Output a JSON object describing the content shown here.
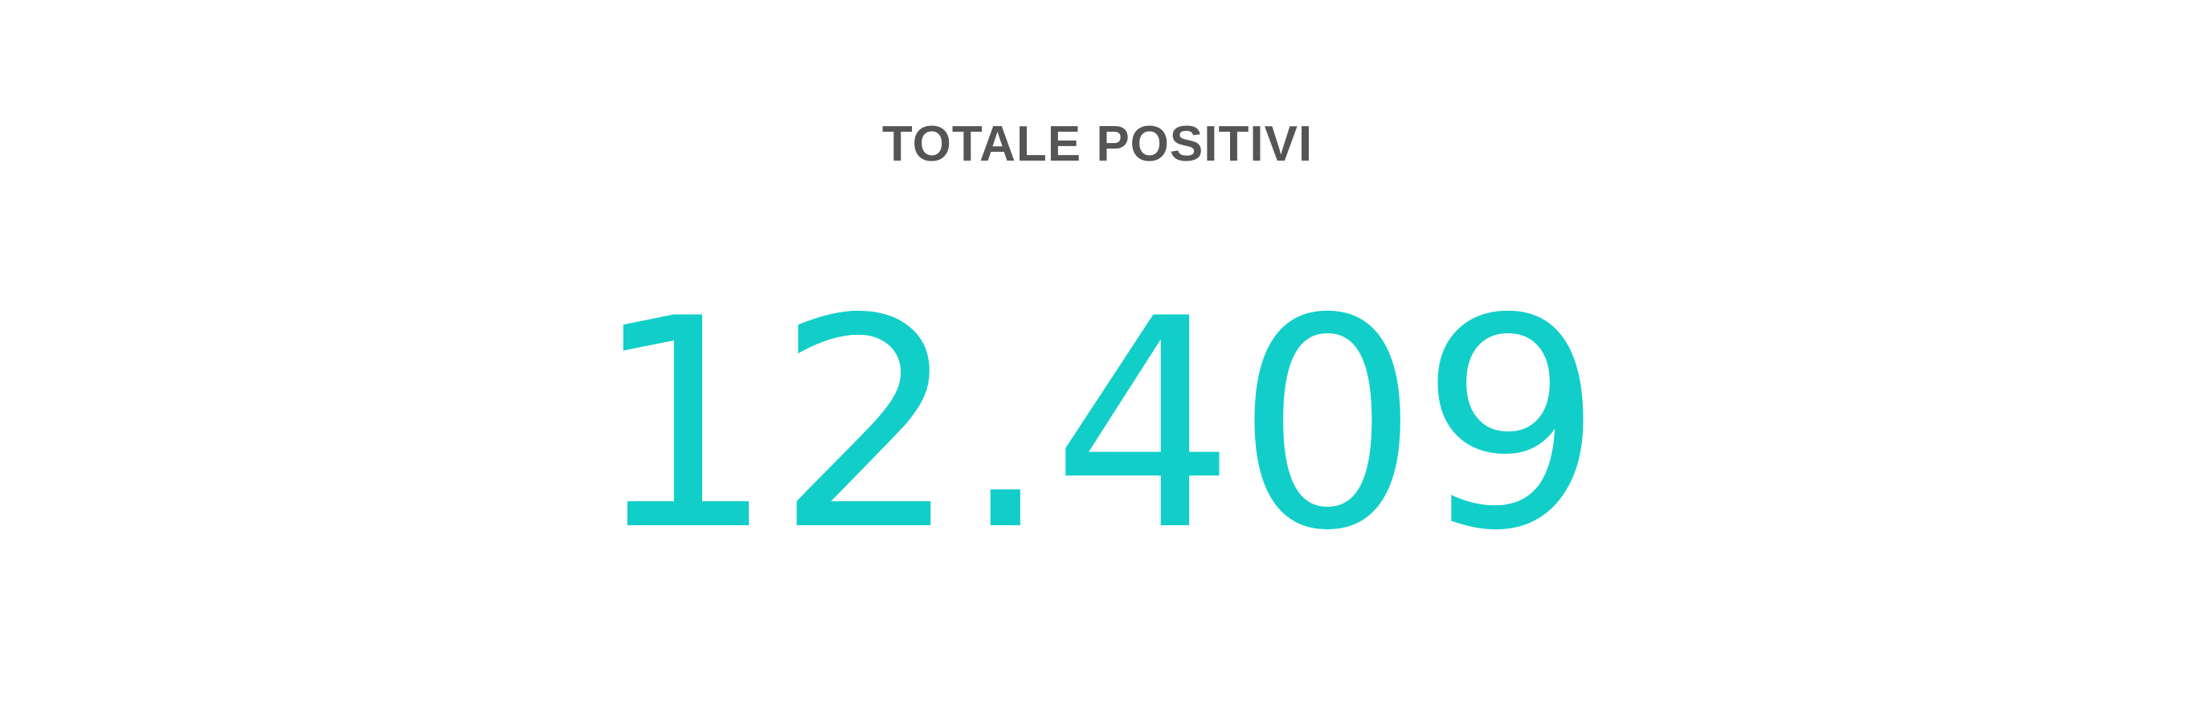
{
  "widget": {
    "title": "TOTALE POSITIVI",
    "value": "12.409"
  },
  "colors": {
    "title": "#555555",
    "value": "#12cec9",
    "background": "#ffffff"
  }
}
